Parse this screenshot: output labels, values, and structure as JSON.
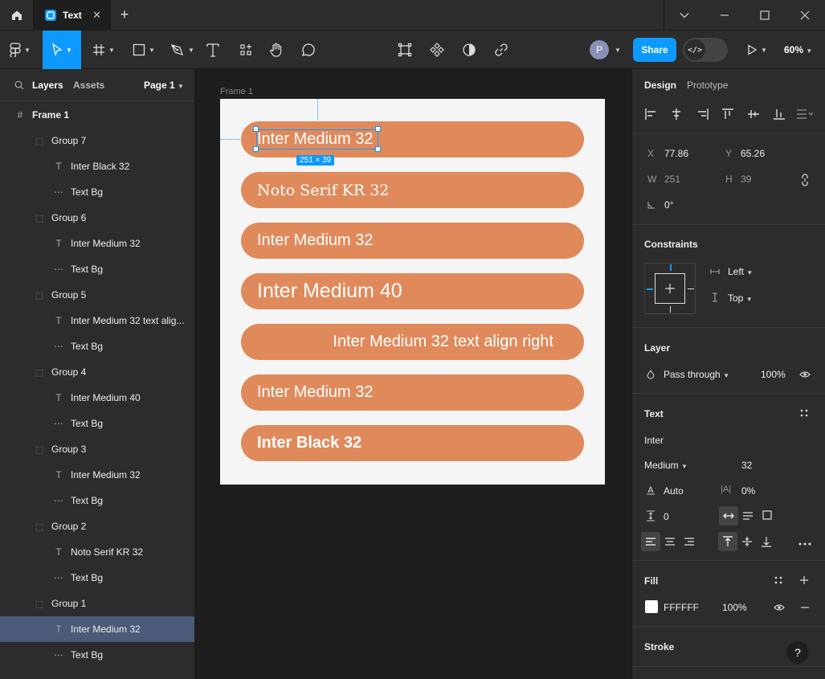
{
  "titlebar": {
    "tab_title": "Text",
    "close_glyph": "✕",
    "new_tab_glyph": "+"
  },
  "toolbar": {
    "avatar_initial": "P",
    "share_label": "Share",
    "devmode_glyph": "</>",
    "zoom": "60%"
  },
  "left_panel": {
    "tab_layers": "Layers",
    "tab_assets": "Assets",
    "page_label": "Page 1",
    "layers": [
      {
        "label": "Frame 1",
        "type": "frame"
      },
      {
        "label": "Group 7",
        "type": "group"
      },
      {
        "label": "Inter Black 32",
        "type": "text"
      },
      {
        "label": "Text Bg",
        "type": "rect"
      },
      {
        "label": "Group 6",
        "type": "group"
      },
      {
        "label": "Inter Medium 32",
        "type": "text"
      },
      {
        "label": "Text Bg",
        "type": "rect"
      },
      {
        "label": "Group 5",
        "type": "group"
      },
      {
        "label": "Inter Medium 32 text alig...",
        "type": "text"
      },
      {
        "label": "Text Bg",
        "type": "rect"
      },
      {
        "label": "Group 4",
        "type": "group"
      },
      {
        "label": "Inter Medium 40",
        "type": "text"
      },
      {
        "label": "Text Bg",
        "type": "rect"
      },
      {
        "label": "Group 3",
        "type": "group"
      },
      {
        "label": "Inter Medium 32",
        "type": "text"
      },
      {
        "label": "Text Bg",
        "type": "rect"
      },
      {
        "label": "Group 2",
        "type": "group"
      },
      {
        "label": "Noto Serif KR 32",
        "type": "text"
      },
      {
        "label": "Text Bg",
        "type": "rect"
      },
      {
        "label": "Group 1",
        "type": "group"
      },
      {
        "label": "Inter Medium 32",
        "type": "text",
        "selected": true
      },
      {
        "label": "Text Bg",
        "type": "rect"
      }
    ]
  },
  "canvas": {
    "frame_label": "Frame 1",
    "selection_size": "251 × 39",
    "pill_color": "#E08A5C",
    "pills": [
      {
        "text": "Inter Medium 32",
        "weight": "medium",
        "align": "left"
      },
      {
        "text": "Noto Serif KR 32",
        "weight": "serif",
        "align": "left"
      },
      {
        "text": "Inter Medium 32",
        "weight": "medium",
        "align": "left"
      },
      {
        "text": "Inter Medium 40",
        "weight": "medium40",
        "align": "left"
      },
      {
        "text": "Inter Medium 32 text align right",
        "weight": "medium",
        "align": "right"
      },
      {
        "text": "Inter Medium 32",
        "weight": "medium",
        "align": "left"
      },
      {
        "text": "Inter Black 32",
        "weight": "black",
        "align": "left"
      }
    ]
  },
  "right_panel": {
    "tab_design": "Design",
    "tab_prototype": "Prototype",
    "x_label": "X",
    "x_value": "77.86",
    "y_label": "Y",
    "y_value": "65.26",
    "w_label": "W",
    "w_value": "251",
    "h_label": "H",
    "h_value": "39",
    "rotation_value": "0°",
    "constraints_title": "Constraints",
    "constraint_h": "Left",
    "constraint_v": "Top",
    "layer_title": "Layer",
    "blend_mode": "Pass through",
    "layer_opacity": "100%",
    "text_title": "Text",
    "font_family": "Inter",
    "font_weight": "Medium",
    "font_size": "32",
    "line_height": "Auto",
    "letter_spacing": "0%",
    "paragraph_spacing": "0",
    "fill_title": "Fill",
    "fill_hex": "FFFFFF",
    "fill_opacity": "100%",
    "stroke_title": "Stroke",
    "help_glyph": "?"
  }
}
